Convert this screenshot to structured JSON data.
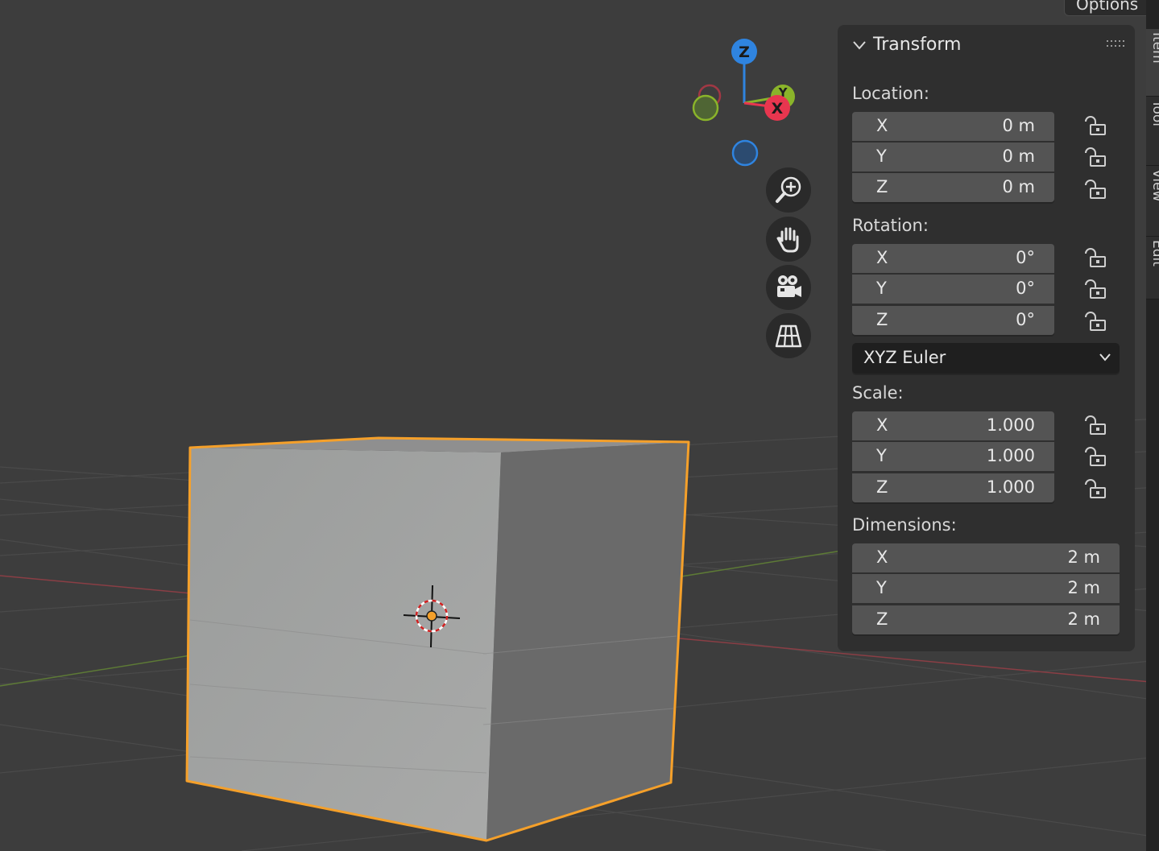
{
  "header": {
    "options_label": "Options"
  },
  "gizmo": {
    "z_label": "Z",
    "y_label": "Y",
    "x_label": "X",
    "colors": {
      "x": "#e8364f",
      "y": "#8ab42a",
      "z": "#2f84e0"
    }
  },
  "nav": {
    "zoom": "zoom-icon",
    "pan": "hand-icon",
    "camera": "camera-icon",
    "ortho": "grid-icon"
  },
  "panel": {
    "title": "Transform",
    "location": {
      "label": "Location:",
      "fields": [
        {
          "axis": "X",
          "value": "0 m"
        },
        {
          "axis": "Y",
          "value": "0 m"
        },
        {
          "axis": "Z",
          "value": "0 m"
        }
      ]
    },
    "rotation": {
      "label": "Rotation:",
      "fields": [
        {
          "axis": "X",
          "value": "0°"
        },
        {
          "axis": "Y",
          "value": "0°"
        },
        {
          "axis": "Z",
          "value": "0°"
        }
      ],
      "mode": "XYZ Euler"
    },
    "scale": {
      "label": "Scale:",
      "fields": [
        {
          "axis": "X",
          "value": "1.000"
        },
        {
          "axis": "Y",
          "value": "1.000"
        },
        {
          "axis": "Z",
          "value": "1.000"
        }
      ]
    },
    "dimensions": {
      "label": "Dimensions:",
      "fields": [
        {
          "axis": "X",
          "value": "2 m"
        },
        {
          "axis": "Y",
          "value": "2 m"
        },
        {
          "axis": "Z",
          "value": "2 m"
        }
      ]
    }
  },
  "sidebar_tabs": [
    "Item",
    "Tool",
    "View",
    "Edit"
  ],
  "selection_color": "#f5a02a"
}
